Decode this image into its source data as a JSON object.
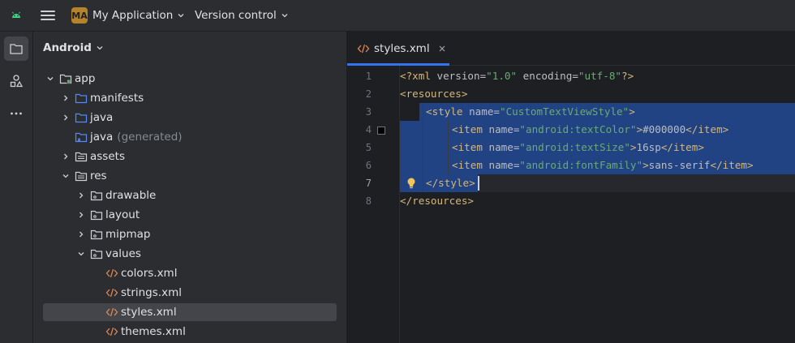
{
  "header": {
    "project_badge": "MA",
    "project_name": "My Application",
    "vcs_label": "Version control"
  },
  "toolstrip": {
    "items": [
      "folder-icon",
      "shapes-icon",
      "more-icon"
    ]
  },
  "project_panel": {
    "view_label": "Android",
    "tree": [
      {
        "label": "app",
        "suffix": ""
      },
      {
        "label": "manifests",
        "suffix": ""
      },
      {
        "label": "java",
        "suffix": ""
      },
      {
        "label": "java",
        "suffix": "(generated)"
      },
      {
        "label": "assets",
        "suffix": ""
      },
      {
        "label": "res",
        "suffix": ""
      },
      {
        "label": "drawable",
        "suffix": ""
      },
      {
        "label": "layout",
        "suffix": ""
      },
      {
        "label": "mipmap",
        "suffix": ""
      },
      {
        "label": "values",
        "suffix": ""
      },
      {
        "label": "colors.xml",
        "suffix": ""
      },
      {
        "label": "strings.xml",
        "suffix": ""
      },
      {
        "label": "styles.xml",
        "suffix": ""
      },
      {
        "label": "themes.xml",
        "suffix": ""
      }
    ]
  },
  "editor": {
    "tab_label": "styles.xml",
    "line_numbers": [
      "1",
      "2",
      "3",
      "4",
      "5",
      "6",
      "7",
      "8"
    ],
    "code": {
      "l1": {
        "a": "<?xml ",
        "b": "version=",
        "c": "\"1.0\"",
        "d": " encoding=",
        "e": "\"utf-8\"",
        "f": "?>"
      },
      "l2": {
        "a": "<resources>"
      },
      "l3": {
        "a": "<style ",
        "b": "name=",
        "c": "\"CustomTextViewStyle\"",
        "d": ">"
      },
      "l4": {
        "a": "<item ",
        "b": "name=",
        "c": "\"android:textColor\"",
        "d": ">",
        "e": "#000000",
        "f": "</item>"
      },
      "l5": {
        "a": "<item ",
        "b": "name=",
        "c": "\"android:textSize\"",
        "d": ">",
        "e": "16sp",
        "f": "</item>"
      },
      "l6": {
        "a": "<item ",
        "b": "name=",
        "c": "\"android:fontFamily\"",
        "d": ">",
        "e": "sans-serif",
        "f": "</item>"
      },
      "l7": {
        "a": "</style>"
      },
      "l8": {
        "a": "</resources>"
      }
    }
  },
  "colors": {
    "accent": "#3574f0",
    "selection": "#214283",
    "tag": "#d5b778",
    "string": "#6aab73",
    "badge": "#b6822a"
  }
}
